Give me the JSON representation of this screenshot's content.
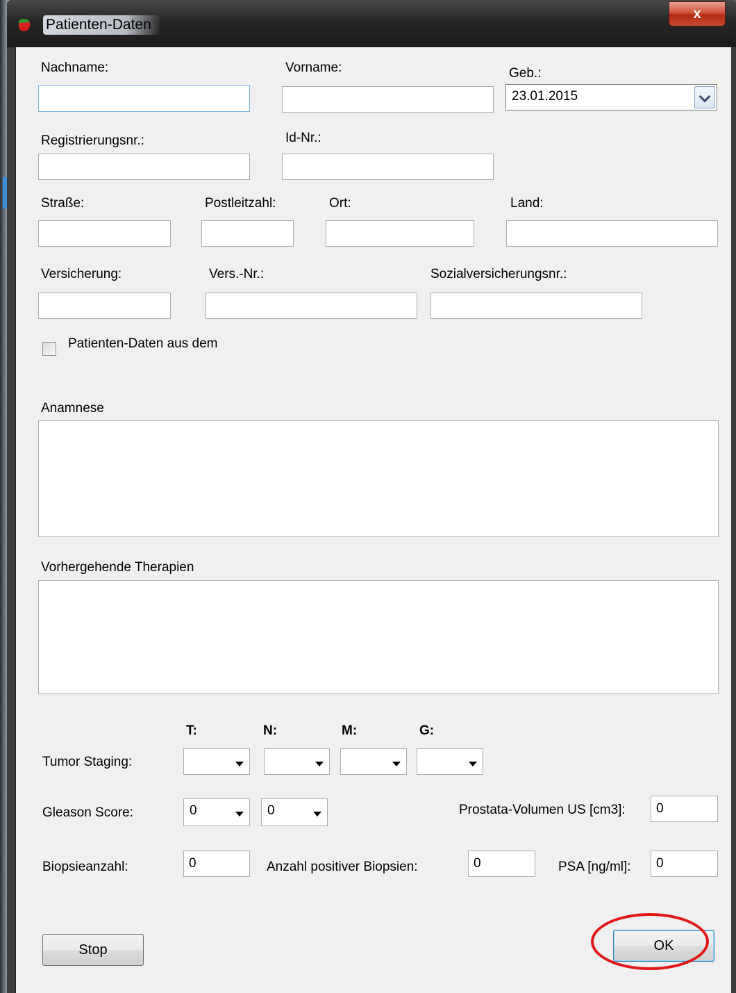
{
  "window": {
    "title": "Patienten-Daten",
    "close_label": "x"
  },
  "fields": {
    "nachname": {
      "label": "Nachname:",
      "value": ""
    },
    "vorname": {
      "label": "Vorname:",
      "value": ""
    },
    "geb": {
      "label": "Geb.:",
      "value": "23.01.2015"
    },
    "registrierungsnr": {
      "label": "Registrierungsnr.:",
      "value": ""
    },
    "idnr": {
      "label": "Id-Nr.:",
      "value": ""
    },
    "strasse": {
      "label": "Straße:",
      "value": ""
    },
    "postleitzahl": {
      "label": "Postleitzahl:",
      "value": ""
    },
    "ort": {
      "label": "Ort:",
      "value": ""
    },
    "land": {
      "label": "Land:",
      "value": ""
    },
    "versicherung": {
      "label": "Versicherung:",
      "value": ""
    },
    "versnr": {
      "label": "Vers.-Nr.:",
      "value": ""
    },
    "sozialversicherungsnr": {
      "label": "Sozialversicherungsnr.:",
      "value": ""
    }
  },
  "checkbox": {
    "label": "Patienten-Daten aus dem",
    "checked": false
  },
  "anamnese": {
    "label": "Anamnese",
    "value": ""
  },
  "therapien": {
    "label": "Vorhergehende Therapien",
    "value": ""
  },
  "staging": {
    "label": "Tumor Staging:",
    "headers": {
      "t": "T:",
      "n": "N:",
      "m": "M:",
      "g": "G:"
    },
    "values": {
      "t": "",
      "n": "",
      "m": "",
      "g": ""
    }
  },
  "gleason": {
    "label": "Gleason Score:",
    "value1": "0",
    "value2": "0"
  },
  "prostata": {
    "label": "Prostata-Volumen US [cm3]:",
    "value": "0"
  },
  "biopsie": {
    "label": "Biopsieanzahl:",
    "value": "0"
  },
  "positive": {
    "label": "Anzahl positiver Biopsien:",
    "value": "0"
  },
  "psa": {
    "label": "PSA [ng/ml]:",
    "value": "0"
  },
  "buttons": {
    "stop": "Stop",
    "ok": "OK"
  },
  "annotation_color": "#e01818"
}
